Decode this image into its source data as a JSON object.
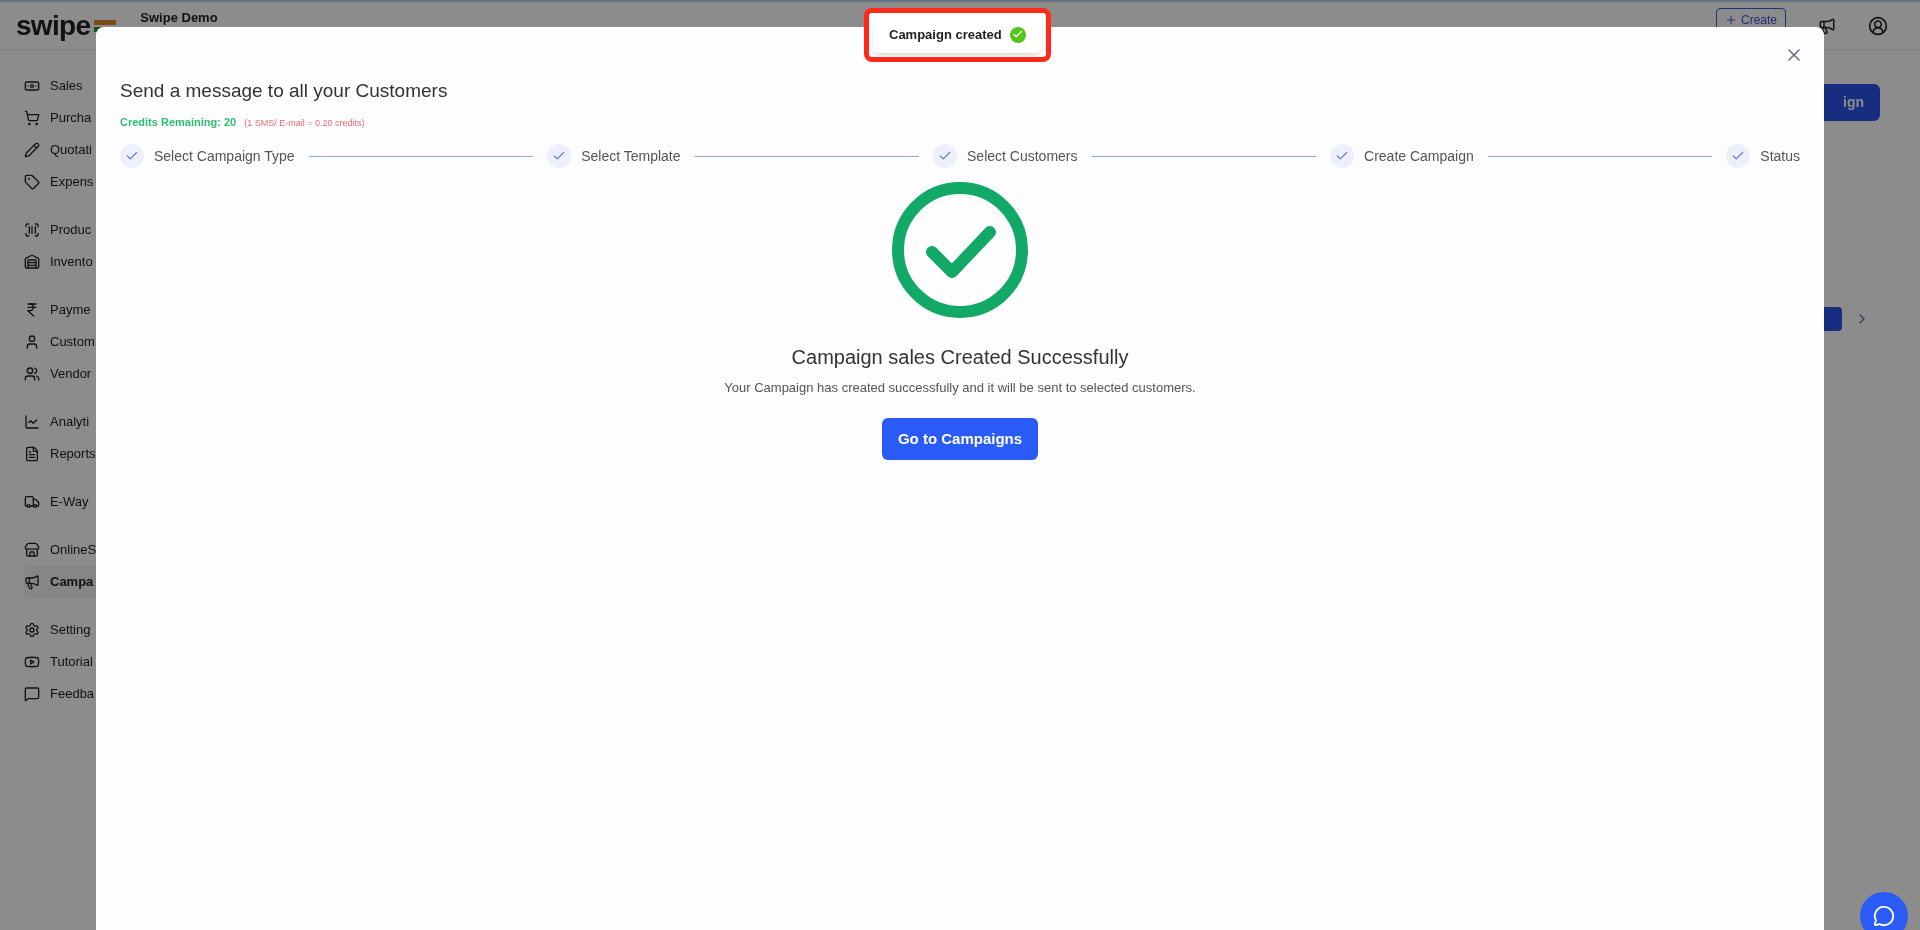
{
  "app": {
    "logo": "swipe",
    "company": "Swipe Demo",
    "create_button": "Create",
    "sidebar": [
      [
        {
          "label": "Sales",
          "selected": false
        },
        {
          "label": "Purcha",
          "selected": false
        },
        {
          "label": "Quotati",
          "selected": false
        },
        {
          "label": "Expens",
          "selected": false
        }
      ],
      [
        {
          "label": "Produc",
          "selected": false
        },
        {
          "label": "Invento",
          "selected": false
        }
      ],
      [
        {
          "label": "Payme",
          "selected": false
        },
        {
          "label": "Custom",
          "selected": false
        },
        {
          "label": "Vendor",
          "selected": false
        }
      ],
      [
        {
          "label": "Analyti",
          "selected": false
        },
        {
          "label": "Reports",
          "selected": false
        }
      ],
      [
        {
          "label": "E-Way",
          "selected": false
        }
      ],
      [
        {
          "label": "OnlineS",
          "selected": false
        },
        {
          "label": "Campa",
          "selected": true
        }
      ],
      [
        {
          "label": "Setting",
          "selected": false
        },
        {
          "label": "Tutorial",
          "selected": false
        },
        {
          "label": "Feedba",
          "selected": false
        }
      ]
    ],
    "background_button": "ign"
  },
  "toast": {
    "message": "Campaign created"
  },
  "modal": {
    "title": "Send a message to all your Customers",
    "credits": "Credits Remaining: 20",
    "credit_note": "(1 SMS/ E-mail = 0.20 credits)",
    "steps": [
      {
        "label": "Select Campaign Type",
        "completed": true
      },
      {
        "label": "Select Template",
        "completed": true
      },
      {
        "label": "Select Customers",
        "completed": true
      },
      {
        "label": "Create Campaign",
        "completed": true
      },
      {
        "label": "Status",
        "completed": true
      }
    ],
    "result": {
      "heading": "Campaign sales Created Successfully",
      "message": "Your Campaign has created successfully and it will be sent to selected customers.",
      "button": "Go to Campaigns"
    }
  }
}
